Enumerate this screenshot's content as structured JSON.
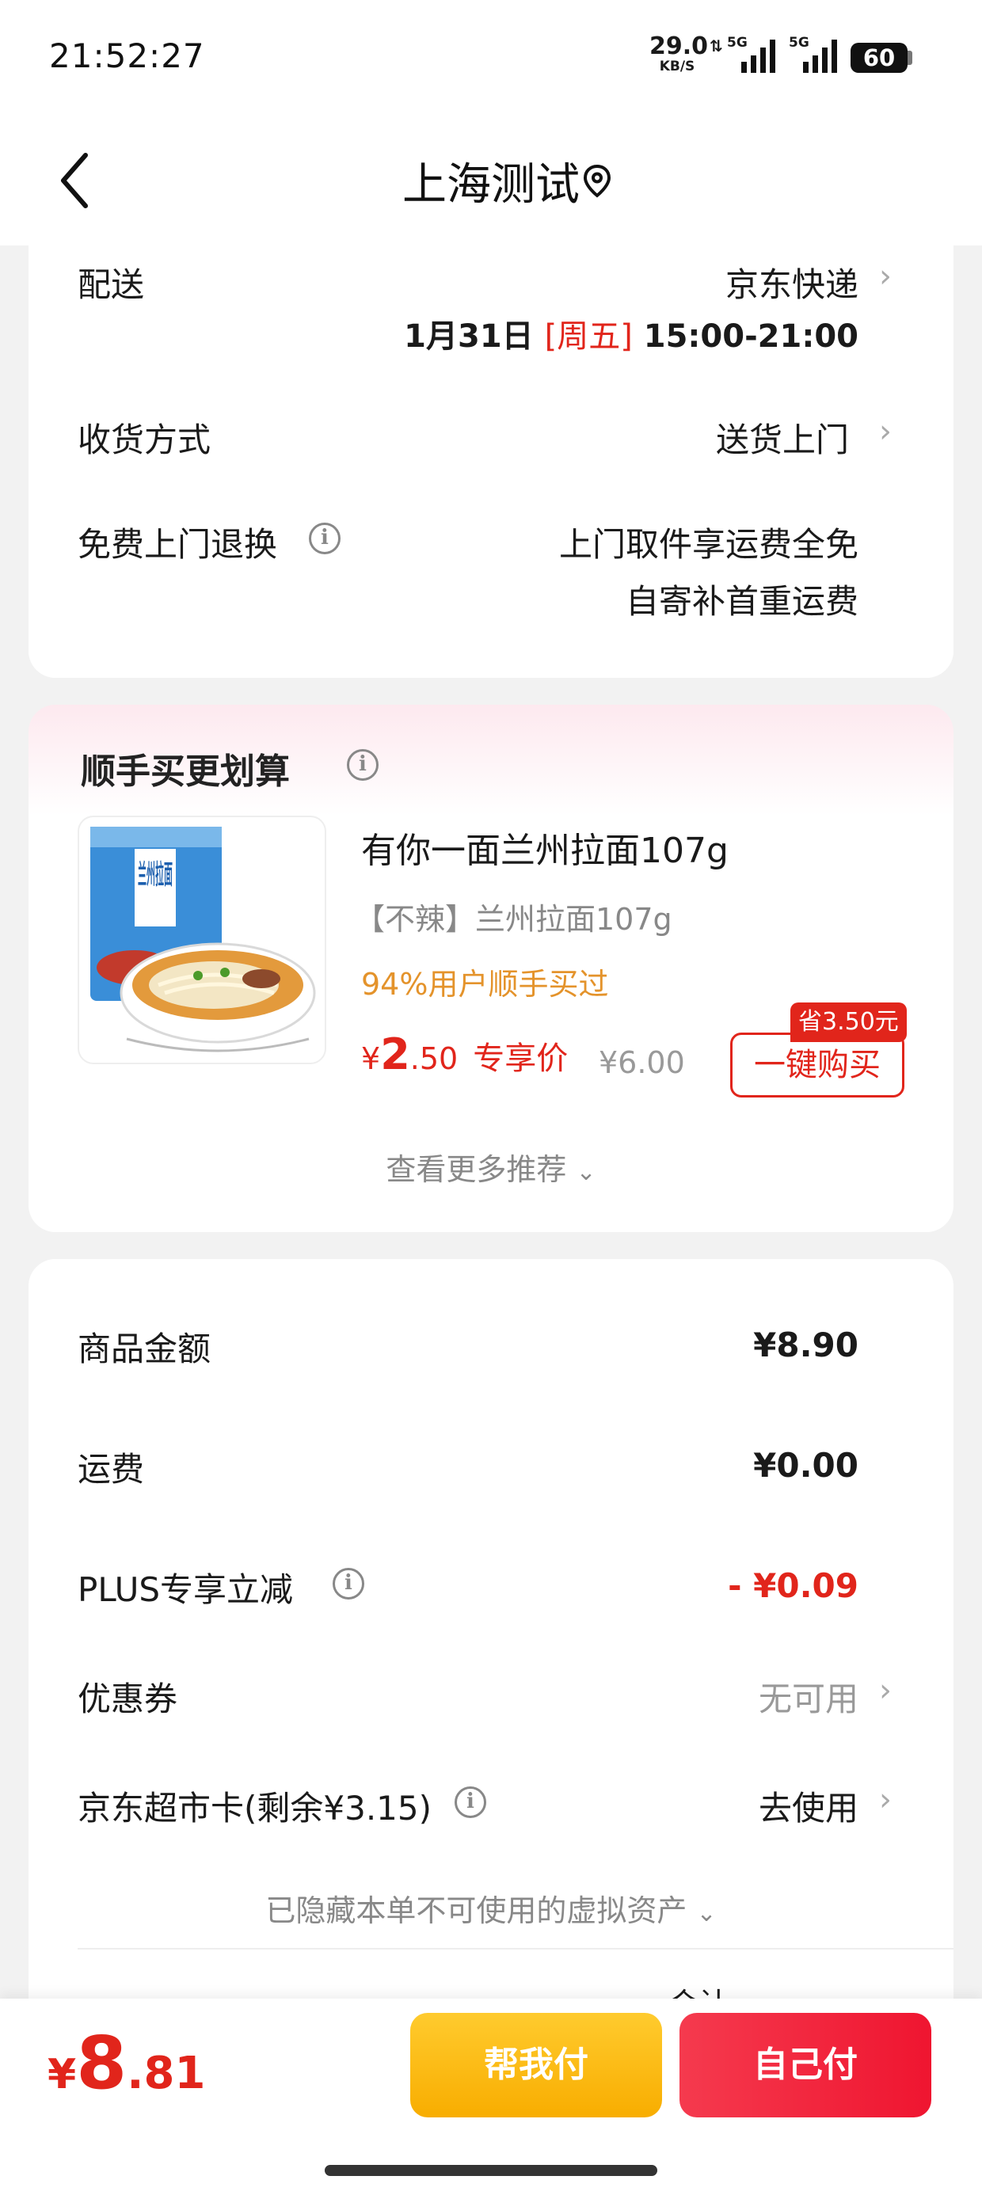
{
  "status_bar": {
    "time": "21:52:27",
    "net_speed": "29.0",
    "net_unit": "KB/S",
    "signal1": "5G",
    "signal2": "5G",
    "battery": "60"
  },
  "header": {
    "title": "上海测试",
    "back_icon": "chevron-left-icon",
    "location_icon": "location-pin-icon"
  },
  "delivery": {
    "label": "配送",
    "carrier": "京东快递",
    "date": "1月31日",
    "weekday": "[周五]",
    "time": "15:00-21:00",
    "receive_label": "收货方式",
    "receive_value": "送货上门",
    "return_label": "免费上门退换",
    "return_line1": "上门取件享运费全免",
    "return_line2": "自寄补首重运费"
  },
  "addon": {
    "title": "顺手买更划算",
    "product_name": "有你一面兰州拉面107g",
    "spec": "【不辣】兰州拉面107g",
    "stat": "94%用户顺手买过",
    "currency": "¥",
    "price_int": "2",
    "price_dec": ".50",
    "price_tag": "专享价",
    "original_price": "¥6.00",
    "save_badge": "省3.50元",
    "buy_label": "一键购买",
    "more_label": "查看更多推荐",
    "package_label": "兰州拉面",
    "colors": {
      "accent": "#e1251b",
      "stat": "#e4932b"
    }
  },
  "summary": {
    "items_label": "商品金额",
    "items_value": "¥8.90",
    "shipping_label": "运费",
    "shipping_value": "¥0.00",
    "plus_label": "PLUS专享立减",
    "plus_value": "- ¥0.09",
    "coupon_label": "优惠券",
    "coupon_value": "无可用",
    "card_label": "京东超市卡(剩余¥3.15)",
    "card_value": "去使用",
    "hidden_label": "已隐藏本单不可使用的虚拟资产",
    "total_partial": "合计"
  },
  "bottom": {
    "currency": "¥",
    "total_int": "8",
    "total_dec": ".81",
    "help_pay": "帮我付",
    "self_pay": "自己付",
    "colors": {
      "help": "#f9b800",
      "self": "#f0213a"
    }
  }
}
